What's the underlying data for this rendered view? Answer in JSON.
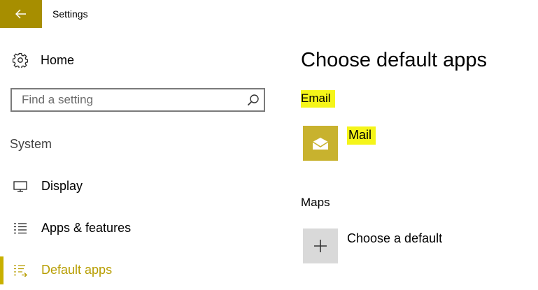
{
  "window": {
    "title": "Settings",
    "accent": "#a78e00"
  },
  "sidebar": {
    "home_label": "Home",
    "search_placeholder": "Find a setting",
    "section_label": "System",
    "items": [
      {
        "label": "Display",
        "icon": "display-icon",
        "active": false
      },
      {
        "label": "Apps & features",
        "icon": "list-icon",
        "active": false
      },
      {
        "label": "Default apps",
        "icon": "default-apps-icon",
        "active": true
      }
    ]
  },
  "main": {
    "title": "Choose default apps",
    "groups": [
      {
        "label": "Email",
        "app": "Mail",
        "icon": "mail-icon",
        "tile_color": "#c8b22e"
      },
      {
        "label": "Maps",
        "app": "Choose a default",
        "icon": "plus-icon",
        "tile_color": "#d9d9d9"
      }
    ],
    "highlight_color": "#f5f519"
  }
}
